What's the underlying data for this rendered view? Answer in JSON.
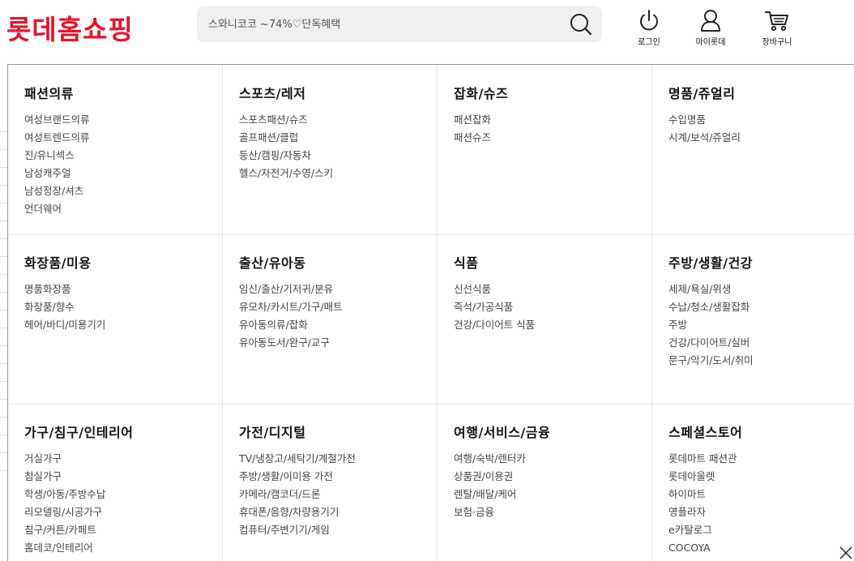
{
  "brand": {
    "logo_text": "롯데홈쇼핑",
    "color": "#e8132b"
  },
  "search": {
    "placeholder": "스와니코코 ~74%♡단독혜택",
    "icon": "search-icon"
  },
  "utils": [
    {
      "label": "로그인",
      "icon": "power-icon"
    },
    {
      "label": "마이롯데",
      "icon": "user-icon"
    },
    {
      "label": "장바구니",
      "icon": "cart-icon"
    }
  ],
  "categories": [
    {
      "title": "패션의류",
      "items": [
        "여성브랜드의류",
        "여성트렌드의류",
        "진/유니섹스",
        "남성캐주얼",
        "남성정장/셔츠",
        "언더웨어"
      ]
    },
    {
      "title": "스포츠/레저",
      "items": [
        "스포츠패션/슈즈",
        "골프패션/클럽",
        "등산/캠핑/자동차",
        "헬스/자전거/수영/스키"
      ]
    },
    {
      "title": "잡화/슈즈",
      "items": [
        "패션잡화",
        "패션슈즈"
      ]
    },
    {
      "title": "명품/쥬얼리",
      "items": [
        "수입명품",
        "시계/보석/쥬얼리"
      ]
    },
    {
      "title": "화장품/미용",
      "items": [
        "명품화장품",
        "화장품/향수",
        "헤어/바디/미용기기"
      ]
    },
    {
      "title": "출산/유아동",
      "items": [
        "임신/출산/기저귀/분유",
        "유모차/카시트/가구/매트",
        "유아동의류/잡화",
        "유아동도서/완구/교구"
      ]
    },
    {
      "title": "식품",
      "items": [
        "신선식품",
        "즉석/가공식품",
        "건강/다이어트 식품"
      ]
    },
    {
      "title": "주방/생활/건강",
      "items": [
        "세제/욕실/위생",
        "수납/청소/생활잡화",
        "주방",
        "건강/다이어트/실버",
        "문구/악기/도서/취미"
      ]
    },
    {
      "title": "가구/침구/인테리어",
      "items": [
        "거실가구",
        "침실가구",
        "학생/아동/주방수납",
        "리모델링/시공가구",
        "침구/커튼/카페트",
        "홈데코/인테리어"
      ]
    },
    {
      "title": "가전/디지털",
      "items": [
        "TV/냉장고/세탁기/계절가전",
        "주방/생활/이미용 가전",
        "카메라/캠코더/드론",
        "휴대폰/음향/차량용기기",
        "컴퓨터/주변기기/게임"
      ]
    },
    {
      "title": "여행/서비스/금융",
      "items": [
        "여행/숙박/렌터카",
        "상품권/이용권",
        "렌탈/배달/케어",
        "보험·금융"
      ]
    },
    {
      "title": "스페셜스토어",
      "items": [
        "롯데마트 패션관",
        "롯데아울렛",
        "하이마트",
        "영플라자",
        "e카탈로그",
        "COCOYA"
      ]
    }
  ],
  "close_icon": "close-icon"
}
